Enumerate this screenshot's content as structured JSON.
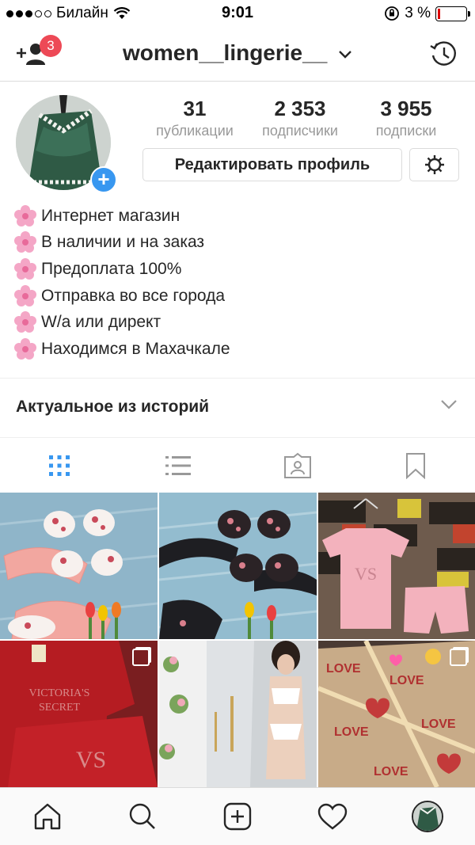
{
  "status_bar": {
    "carrier": "Билайн",
    "time": "9:01",
    "battery": "3 %"
  },
  "header": {
    "username": "women__lingerie__",
    "notification_count": "3"
  },
  "profile": {
    "stats": [
      {
        "value": "31",
        "label": "публикации"
      },
      {
        "value": "2 353",
        "label": "подписчики"
      },
      {
        "value": "3 955",
        "label": "подписки"
      }
    ],
    "edit_button": "Редактировать профиль",
    "bio": [
      "Интернет магазин",
      "В наличии и на заказ",
      "Предоплата 100%",
      "Отправка во все города",
      "W/a или директ",
      "Находимся в Махачкале"
    ]
  },
  "highlights": {
    "title": "Актуальное из историй"
  },
  "tabs": [
    {
      "icon": "grid-icon",
      "active": true
    },
    {
      "icon": "list-icon",
      "active": false
    },
    {
      "icon": "tagged-icon",
      "active": false
    },
    {
      "icon": "saved-icon",
      "active": false
    }
  ],
  "posts": [
    {
      "name": "post-floral-bra-sets-pink"
    },
    {
      "name": "post-floral-bra-sets-black"
    },
    {
      "name": "post-victorias-secret-pink-pajama"
    },
    {
      "name": "post-victorias-secret-red-set",
      "multi": true
    },
    {
      "name": "post-white-lace-lingerie-model"
    },
    {
      "name": "post-love-gift-wrap",
      "multi": true
    }
  ],
  "nav": [
    {
      "icon": "home-icon"
    },
    {
      "icon": "search-icon"
    },
    {
      "icon": "new-post-icon"
    },
    {
      "icon": "activity-heart-icon"
    },
    {
      "icon": "profile-avatar-icon"
    }
  ],
  "colors": {
    "accent": "#3897f0",
    "badge": "#ed4956",
    "border": "#dbdbdb",
    "muted_text": "#999999"
  }
}
